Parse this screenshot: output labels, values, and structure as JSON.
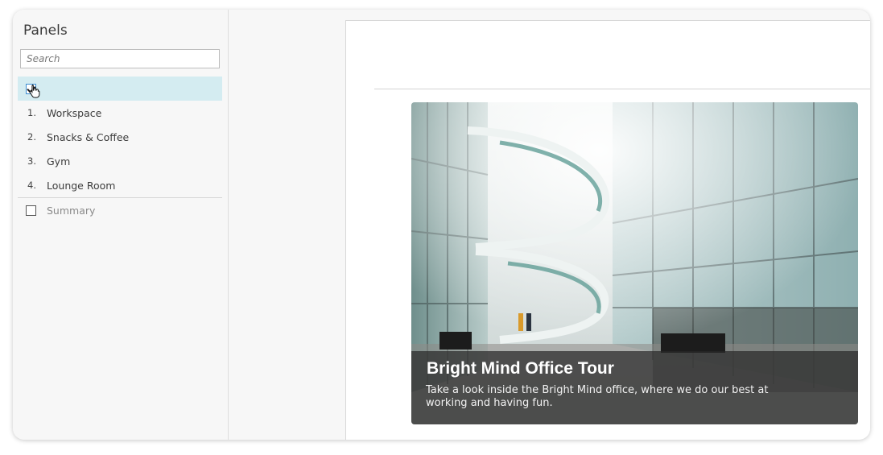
{
  "sidebar": {
    "title": "Panels",
    "search_placeholder": "Search",
    "items": [
      {
        "number": "1.",
        "label": "Workspace"
      },
      {
        "number": "2.",
        "label": "Snacks & Coffee"
      },
      {
        "number": "3.",
        "label": "Gym"
      },
      {
        "number": "4.",
        "label": "Lounge Room"
      }
    ],
    "summary_label": "Summary"
  },
  "card": {
    "title": "Bright Mind Office Tour",
    "description": "Take a look inside the Bright Mind office, where we do our best at working and having fun."
  },
  "icons": {
    "cursor": "hand-pointer-icon",
    "checkbox_checked": "checkmark-icon"
  },
  "colors": {
    "selected_row": "#d4ecf1",
    "caption_overlay": "#282828"
  }
}
